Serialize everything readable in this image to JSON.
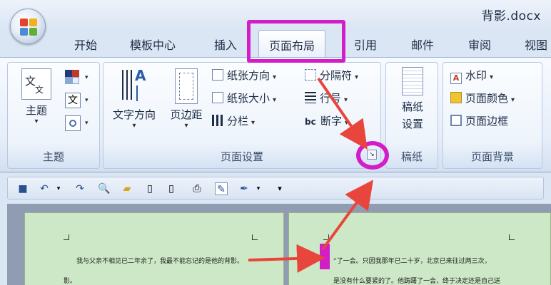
{
  "window": {
    "title": "背影.docx"
  },
  "tabs": [
    {
      "label": "开始",
      "active": false
    },
    {
      "label": "模板中心",
      "active": false
    },
    {
      "label": "插入",
      "active": false
    },
    {
      "label": "页面布局",
      "active": true
    },
    {
      "label": "引用",
      "active": false
    },
    {
      "label": "邮件",
      "active": false
    },
    {
      "label": "审阅",
      "active": false
    },
    {
      "label": "视图",
      "active": false
    }
  ],
  "ribbon": {
    "theme_group": {
      "label": "主题",
      "themes_button": "主题"
    },
    "page_setup_group": {
      "label": "页面设置",
      "text_direction": "文字方向",
      "margins": "页边距",
      "orientation": "纸张方向",
      "size": "纸张大小",
      "columns": "分栏",
      "breaks": "分隔符",
      "line_numbers": "行号",
      "hyphenation": "断字",
      "hyphen_icon_text": "bc"
    },
    "draft_paper_group": {
      "label": "稿纸",
      "button": "稿纸设置"
    },
    "page_background_group": {
      "label": "页面背景",
      "watermark": "水印",
      "page_color": "页面颜色",
      "page_borders": "页面边框"
    }
  },
  "document": {
    "left_page_lines": [
      "我与父亲不相见已二年余了，我最不能忘记的是他的背影。",
      "影。"
    ],
    "right_page_lines": [
      "“了一会。只因我那年已二十岁，北京已来往过两三次，",
      "是没有什么要紧的了。他踌躇了一会，终于决定还是自己送"
    ]
  },
  "colors": {
    "highlight": "#d11ec8",
    "arrow": "#e8463c",
    "page_bg": "#cde8c6"
  }
}
